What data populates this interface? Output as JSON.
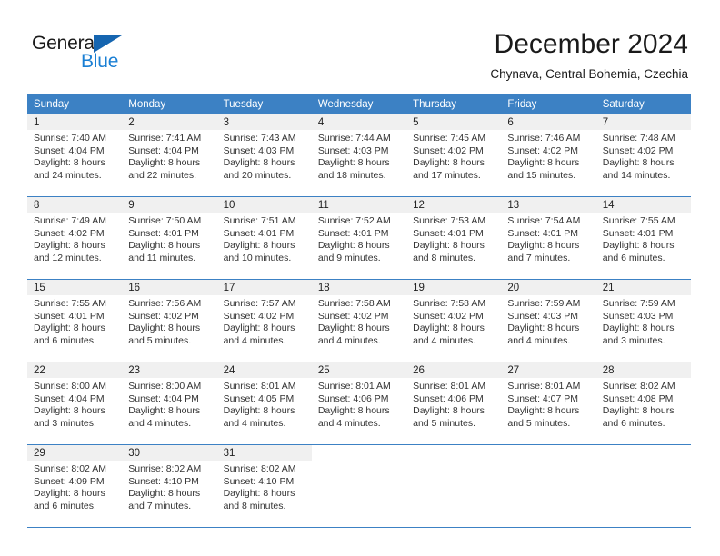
{
  "brand": {
    "name_part1": "General",
    "name_part2": "Blue",
    "flag_icon": "triangle-flag-icon"
  },
  "header": {
    "title": "December 2024",
    "subtitle": "Chynava, Central Bohemia, Czechia"
  },
  "colors": {
    "header_blue": "#3c81c4",
    "brand_blue": "#1a7fd4",
    "flag_blue": "#1565b0",
    "daynum_band": "#f0f0f0"
  },
  "weekday_headers": [
    "Sunday",
    "Monday",
    "Tuesday",
    "Wednesday",
    "Thursday",
    "Friday",
    "Saturday"
  ],
  "weeks": [
    [
      {
        "day": "1",
        "sunrise": "Sunrise: 7:40 AM",
        "sunset": "Sunset: 4:04 PM",
        "daylight_line1": "Daylight: 8 hours",
        "daylight_line2": "and 24 minutes."
      },
      {
        "day": "2",
        "sunrise": "Sunrise: 7:41 AM",
        "sunset": "Sunset: 4:04 PM",
        "daylight_line1": "Daylight: 8 hours",
        "daylight_line2": "and 22 minutes."
      },
      {
        "day": "3",
        "sunrise": "Sunrise: 7:43 AM",
        "sunset": "Sunset: 4:03 PM",
        "daylight_line1": "Daylight: 8 hours",
        "daylight_line2": "and 20 minutes."
      },
      {
        "day": "4",
        "sunrise": "Sunrise: 7:44 AM",
        "sunset": "Sunset: 4:03 PM",
        "daylight_line1": "Daylight: 8 hours",
        "daylight_line2": "and 18 minutes."
      },
      {
        "day": "5",
        "sunrise": "Sunrise: 7:45 AM",
        "sunset": "Sunset: 4:02 PM",
        "daylight_line1": "Daylight: 8 hours",
        "daylight_line2": "and 17 minutes."
      },
      {
        "day": "6",
        "sunrise": "Sunrise: 7:46 AM",
        "sunset": "Sunset: 4:02 PM",
        "daylight_line1": "Daylight: 8 hours",
        "daylight_line2": "and 15 minutes."
      },
      {
        "day": "7",
        "sunrise": "Sunrise: 7:48 AM",
        "sunset": "Sunset: 4:02 PM",
        "daylight_line1": "Daylight: 8 hours",
        "daylight_line2": "and 14 minutes."
      }
    ],
    [
      {
        "day": "8",
        "sunrise": "Sunrise: 7:49 AM",
        "sunset": "Sunset: 4:02 PM",
        "daylight_line1": "Daylight: 8 hours",
        "daylight_line2": "and 12 minutes."
      },
      {
        "day": "9",
        "sunrise": "Sunrise: 7:50 AM",
        "sunset": "Sunset: 4:01 PM",
        "daylight_line1": "Daylight: 8 hours",
        "daylight_line2": "and 11 minutes."
      },
      {
        "day": "10",
        "sunrise": "Sunrise: 7:51 AM",
        "sunset": "Sunset: 4:01 PM",
        "daylight_line1": "Daylight: 8 hours",
        "daylight_line2": "and 10 minutes."
      },
      {
        "day": "11",
        "sunrise": "Sunrise: 7:52 AM",
        "sunset": "Sunset: 4:01 PM",
        "daylight_line1": "Daylight: 8 hours",
        "daylight_line2": "and 9 minutes."
      },
      {
        "day": "12",
        "sunrise": "Sunrise: 7:53 AM",
        "sunset": "Sunset: 4:01 PM",
        "daylight_line1": "Daylight: 8 hours",
        "daylight_line2": "and 8 minutes."
      },
      {
        "day": "13",
        "sunrise": "Sunrise: 7:54 AM",
        "sunset": "Sunset: 4:01 PM",
        "daylight_line1": "Daylight: 8 hours",
        "daylight_line2": "and 7 minutes."
      },
      {
        "day": "14",
        "sunrise": "Sunrise: 7:55 AM",
        "sunset": "Sunset: 4:01 PM",
        "daylight_line1": "Daylight: 8 hours",
        "daylight_line2": "and 6 minutes."
      }
    ],
    [
      {
        "day": "15",
        "sunrise": "Sunrise: 7:55 AM",
        "sunset": "Sunset: 4:01 PM",
        "daylight_line1": "Daylight: 8 hours",
        "daylight_line2": "and 6 minutes."
      },
      {
        "day": "16",
        "sunrise": "Sunrise: 7:56 AM",
        "sunset": "Sunset: 4:02 PM",
        "daylight_line1": "Daylight: 8 hours",
        "daylight_line2": "and 5 minutes."
      },
      {
        "day": "17",
        "sunrise": "Sunrise: 7:57 AM",
        "sunset": "Sunset: 4:02 PM",
        "daylight_line1": "Daylight: 8 hours",
        "daylight_line2": "and 4 minutes."
      },
      {
        "day": "18",
        "sunrise": "Sunrise: 7:58 AM",
        "sunset": "Sunset: 4:02 PM",
        "daylight_line1": "Daylight: 8 hours",
        "daylight_line2": "and 4 minutes."
      },
      {
        "day": "19",
        "sunrise": "Sunrise: 7:58 AM",
        "sunset": "Sunset: 4:02 PM",
        "daylight_line1": "Daylight: 8 hours",
        "daylight_line2": "and 4 minutes."
      },
      {
        "day": "20",
        "sunrise": "Sunrise: 7:59 AM",
        "sunset": "Sunset: 4:03 PM",
        "daylight_line1": "Daylight: 8 hours",
        "daylight_line2": "and 4 minutes."
      },
      {
        "day": "21",
        "sunrise": "Sunrise: 7:59 AM",
        "sunset": "Sunset: 4:03 PM",
        "daylight_line1": "Daylight: 8 hours",
        "daylight_line2": "and 3 minutes."
      }
    ],
    [
      {
        "day": "22",
        "sunrise": "Sunrise: 8:00 AM",
        "sunset": "Sunset: 4:04 PM",
        "daylight_line1": "Daylight: 8 hours",
        "daylight_line2": "and 3 minutes."
      },
      {
        "day": "23",
        "sunrise": "Sunrise: 8:00 AM",
        "sunset": "Sunset: 4:04 PM",
        "daylight_line1": "Daylight: 8 hours",
        "daylight_line2": "and 4 minutes."
      },
      {
        "day": "24",
        "sunrise": "Sunrise: 8:01 AM",
        "sunset": "Sunset: 4:05 PM",
        "daylight_line1": "Daylight: 8 hours",
        "daylight_line2": "and 4 minutes."
      },
      {
        "day": "25",
        "sunrise": "Sunrise: 8:01 AM",
        "sunset": "Sunset: 4:06 PM",
        "daylight_line1": "Daylight: 8 hours",
        "daylight_line2": "and 4 minutes."
      },
      {
        "day": "26",
        "sunrise": "Sunrise: 8:01 AM",
        "sunset": "Sunset: 4:06 PM",
        "daylight_line1": "Daylight: 8 hours",
        "daylight_line2": "and 5 minutes."
      },
      {
        "day": "27",
        "sunrise": "Sunrise: 8:01 AM",
        "sunset": "Sunset: 4:07 PM",
        "daylight_line1": "Daylight: 8 hours",
        "daylight_line2": "and 5 minutes."
      },
      {
        "day": "28",
        "sunrise": "Sunrise: 8:02 AM",
        "sunset": "Sunset: 4:08 PM",
        "daylight_line1": "Daylight: 8 hours",
        "daylight_line2": "and 6 minutes."
      }
    ],
    [
      {
        "day": "29",
        "sunrise": "Sunrise: 8:02 AM",
        "sunset": "Sunset: 4:09 PM",
        "daylight_line1": "Daylight: 8 hours",
        "daylight_line2": "and 6 minutes."
      },
      {
        "day": "30",
        "sunrise": "Sunrise: 8:02 AM",
        "sunset": "Sunset: 4:10 PM",
        "daylight_line1": "Daylight: 8 hours",
        "daylight_line2": "and 7 minutes."
      },
      {
        "day": "31",
        "sunrise": "Sunrise: 8:02 AM",
        "sunset": "Sunset: 4:10 PM",
        "daylight_line1": "Daylight: 8 hours",
        "daylight_line2": "and 8 minutes."
      },
      {
        "day": "",
        "sunrise": "",
        "sunset": "",
        "daylight_line1": "",
        "daylight_line2": ""
      },
      {
        "day": "",
        "sunrise": "",
        "sunset": "",
        "daylight_line1": "",
        "daylight_line2": ""
      },
      {
        "day": "",
        "sunrise": "",
        "sunset": "",
        "daylight_line1": "",
        "daylight_line2": ""
      },
      {
        "day": "",
        "sunrise": "",
        "sunset": "",
        "daylight_line1": "",
        "daylight_line2": ""
      }
    ]
  ]
}
